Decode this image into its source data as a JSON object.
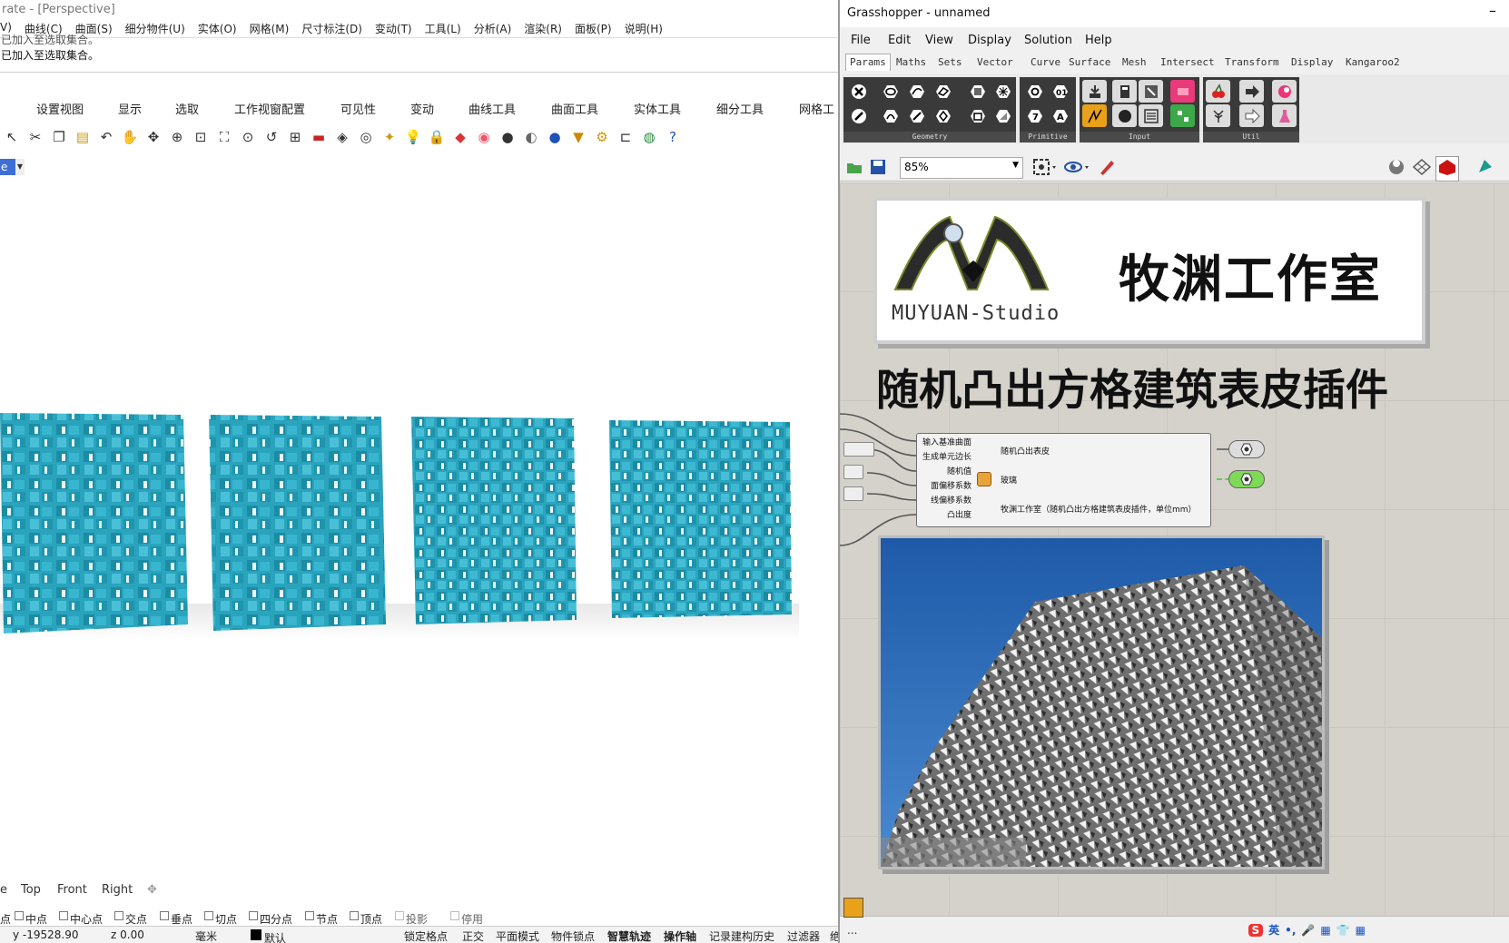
{
  "rhino": {
    "title": "rate - [Perspective]",
    "menu": [
      "V)",
      "曲线(C)",
      "曲面(S)",
      "细分物件(U)",
      "实体(O)",
      "网格(M)",
      "尺寸标注(D)",
      "变动(T)",
      "工具(L)",
      "分析(A)",
      "渲染(R)",
      "面板(P)",
      "说明(H)"
    ],
    "command_history": [
      "已加入至选取集合。",
      "已加入至选取集合。"
    ],
    "toolbar_tabs": [
      "设置视图",
      "显示",
      "选取",
      "工作视窗配置",
      "可见性",
      "变动",
      "曲线工具",
      "曲面工具",
      "实体工具",
      "细分工具",
      "网格工"
    ],
    "viewport_label": "e",
    "viewport_tabs": [
      "e",
      "Top",
      "Front",
      "Right"
    ],
    "osnaps": [
      "点",
      "中点",
      "中心点",
      "交点",
      "垂点",
      "切点",
      "四分点",
      "节点",
      "顶点",
      "投影",
      "停用"
    ],
    "status": {
      "y": "y -19528.90",
      "z": "z 0.00",
      "units": "毫米",
      "layer": "默认",
      "toggles": [
        "锁定格点",
        "正交",
        "平面模式",
        "物件锁点",
        "智慧轨迹",
        "操作轴",
        "记录建构历史",
        "过滤器",
        "绝"
      ]
    }
  },
  "grasshopper": {
    "title": "Grasshopper - unnamed",
    "minimize": "–",
    "menu": [
      "File",
      "Edit",
      "View",
      "Display",
      "Solution",
      "Help"
    ],
    "tabs": [
      "Params",
      "Maths",
      "Sets",
      "Vector",
      "Curve",
      "Surface",
      "Mesh",
      "Intersect",
      "Transform",
      "Display",
      "Kangaroo2"
    ],
    "ribbon_groups": [
      "Geometry",
      "Primitive",
      "Input",
      "Util"
    ],
    "zoom": "85%",
    "logo_title": "牧渊工作室",
    "logo_subtitle": "MUYUAN-Studio",
    "heading": "随机凸出方格建筑表皮插件",
    "component": {
      "inputs": [
        "输入基准曲面",
        "生成单元边长",
        "随机值",
        "面偏移系数",
        "线偏移系数",
        "凸出度"
      ],
      "outputs": [
        "随机凸出表皮",
        "玻璃",
        "牧渊工作室（随机凸出方格建筑表皮插件，单位mm）"
      ]
    },
    "footer": "...",
    "ime": {
      "lang": "英",
      "punct": "•,",
      "logo": "S"
    }
  },
  "colors": {
    "panel_blue": "#2aa3bd",
    "viewport_tag": "#3d6fd6",
    "sky": "#2a67b5"
  }
}
